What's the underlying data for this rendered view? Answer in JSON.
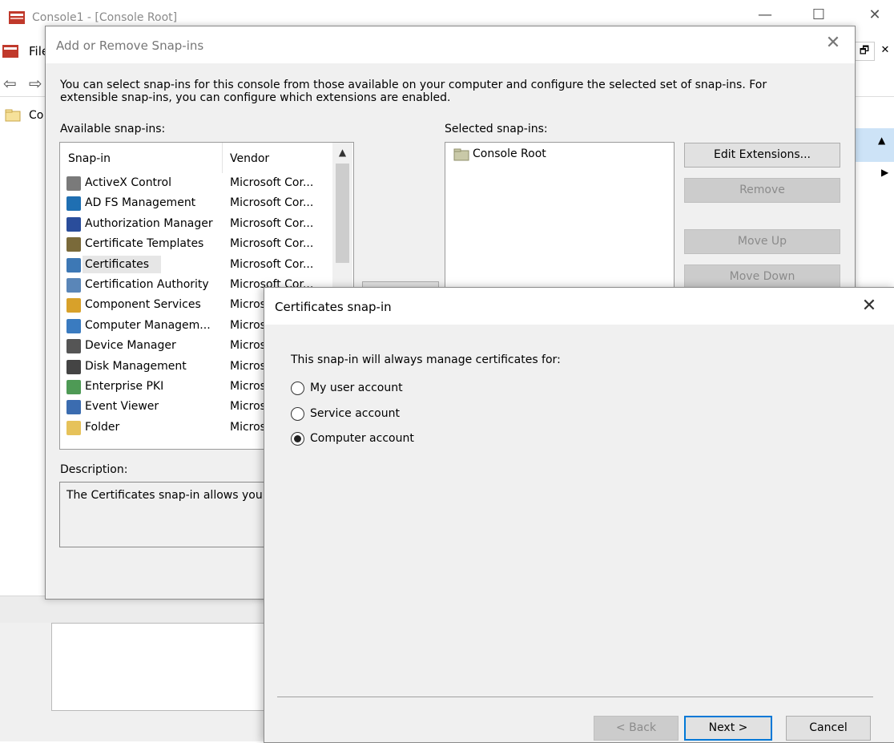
{
  "console": {
    "title": "Console1 - [Console Root]",
    "menu_first": "File",
    "tree_first": "Co",
    "minimize": "—",
    "maximize": "☐",
    "close": "✕",
    "restore": "🗗",
    "close_small": "✕"
  },
  "add_remove": {
    "title": "Add or Remove Snap-ins",
    "intro": "You can select snap-ins for this console from those available on your computer and configure the selected set of snap-ins. For extensible snap-ins, you can configure which extensions are enabled.",
    "available_label": "Available snap-ins:",
    "selected_label": "Selected snap-ins:",
    "columns": {
      "snapin": "Snap-in",
      "vendor": "Vendor"
    },
    "snapins": [
      {
        "name": "ActiveX Control",
        "vendor": "Microsoft Cor...",
        "icon": "activex-icon"
      },
      {
        "name": "AD FS Management",
        "vendor": "Microsoft Cor...",
        "icon": "adfs-icon"
      },
      {
        "name": "Authorization Manager",
        "vendor": "Microsoft Cor...",
        "icon": "authorization-manager-icon"
      },
      {
        "name": "Certificate Templates",
        "vendor": "Microsoft Cor...",
        "icon": "certificate-templates-icon"
      },
      {
        "name": "Certificates",
        "vendor": "Microsoft Cor...",
        "icon": "certificates-icon",
        "selected": true
      },
      {
        "name": "Certification Authority",
        "vendor": "Microsoft Cor...",
        "icon": "certification-authority-icon"
      },
      {
        "name": "Component Services",
        "vendor": "Micros",
        "icon": "component-services-icon"
      },
      {
        "name": "Computer Managem...",
        "vendor": "Micros",
        "icon": "computer-management-icon"
      },
      {
        "name": "Device Manager",
        "vendor": "Micros",
        "icon": "device-manager-icon"
      },
      {
        "name": "Disk Management",
        "vendor": "Micros",
        "icon": "disk-management-icon"
      },
      {
        "name": "Enterprise PKI",
        "vendor": "Micros",
        "icon": "enterprise-pki-icon"
      },
      {
        "name": "Event Viewer",
        "vendor": "Micros",
        "icon": "event-viewer-icon"
      },
      {
        "name": "Folder",
        "vendor": "Micros",
        "icon": "folder-icon"
      }
    ],
    "selected_items": [
      {
        "name": "Console Root",
        "icon": "folder-icon"
      }
    ],
    "buttons": {
      "edit_extensions": "Edit Extensions...",
      "remove": "Remove",
      "move_up": "Move Up",
      "move_down": "Move Down"
    },
    "description_label": "Description:",
    "description_text": "The Certificates snap-in allows you"
  },
  "cert_dialog": {
    "title": "Certificates snap-in",
    "prompt": "This snap-in will always manage certificates for:",
    "options": [
      {
        "label": "My user account",
        "checked": false
      },
      {
        "label": "Service account",
        "checked": false
      },
      {
        "label": "Computer account",
        "checked": true
      }
    ],
    "back": "< Back",
    "next": "Next >",
    "cancel": "Cancel"
  },
  "colors": {
    "accent": "#0078d7",
    "dialog_bg": "#f0f0f0",
    "disabled_text": "#8b8b8b"
  }
}
